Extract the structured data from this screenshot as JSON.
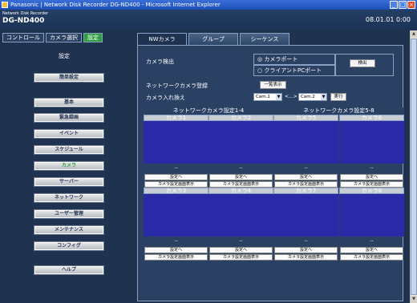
{
  "window": {
    "title": "Panasonic | Network Disk Recorder DG-ND400 - Microsoft Internet Explorer"
  },
  "header": {
    "subtitle": "Network Disk Recorder",
    "model": "DG-ND400",
    "clock": "08.01.01  0:00"
  },
  "nav": {
    "tabs": [
      "コントロール",
      "カメラ選択",
      "設定"
    ],
    "title": "設定",
    "items": [
      "簡単設定",
      "基本",
      "緊急録画",
      "イベント",
      "スケジュール",
      "カメラ",
      "サーバー",
      "ネットワーク",
      "ユーザー管理",
      "メンテナンス",
      "コンフィグ",
      "ヘルプ"
    ],
    "active_item": "カメラ"
  },
  "subtabs": [
    "NWカメラ",
    "グループ",
    "シーケンス"
  ],
  "detect": {
    "label": "カメラ検出",
    "option1": "◎ カメラポート",
    "option2": "○ クライアントPCポート",
    "button": "検出"
  },
  "register": {
    "label": "ネットワークカメラ登録",
    "button": "一覧表示"
  },
  "swap": {
    "label": "カメラ入れ換え",
    "from": "Cam.1",
    "arrow": "<...>",
    "to": "Cam.2",
    "button": "実行"
  },
  "groups": [
    "ネットワークカメラ設定1-4",
    "ネットワークカメラ設定5-8"
  ],
  "cameras_row1": [
    {
      "name": "カメラ1",
      "status": "--",
      "btn1": "設定へ",
      "btn2": "カメラ設定画面表示"
    },
    {
      "name": "カメラ2",
      "status": "--",
      "btn1": "設定へ",
      "btn2": "カメラ設定画面表示"
    },
    {
      "name": "カメラ5",
      "status": "--",
      "btn1": "設定へ",
      "btn2": "カメラ設定画面表示"
    },
    {
      "name": "カメラ6",
      "status": "--",
      "btn1": "設定へ",
      "btn2": "カメラ設定画面表示"
    }
  ],
  "cameras_row2": [
    {
      "name": "カメラ3",
      "status": "--",
      "btn1": "設定へ",
      "btn2": "カメラ設定画面表示"
    },
    {
      "name": "カメラ4",
      "status": "--",
      "btn1": "設定へ",
      "btn2": "カメラ設定画面表示"
    },
    {
      "name": "カメラ7",
      "status": "--",
      "btn1": "設定へ",
      "btn2": "カメラ設定画面表示"
    },
    {
      "name": "カメラ8",
      "status": "--",
      "btn1": "設定へ",
      "btn2": "カメラ設定画面表示"
    }
  ],
  "colors": {
    "header_bg": "#1b3355",
    "nav_bg": "#1f3350",
    "panel_bg": "#2a4164",
    "camera_view": "#2a2aa8",
    "active_green": "#2fa040"
  }
}
